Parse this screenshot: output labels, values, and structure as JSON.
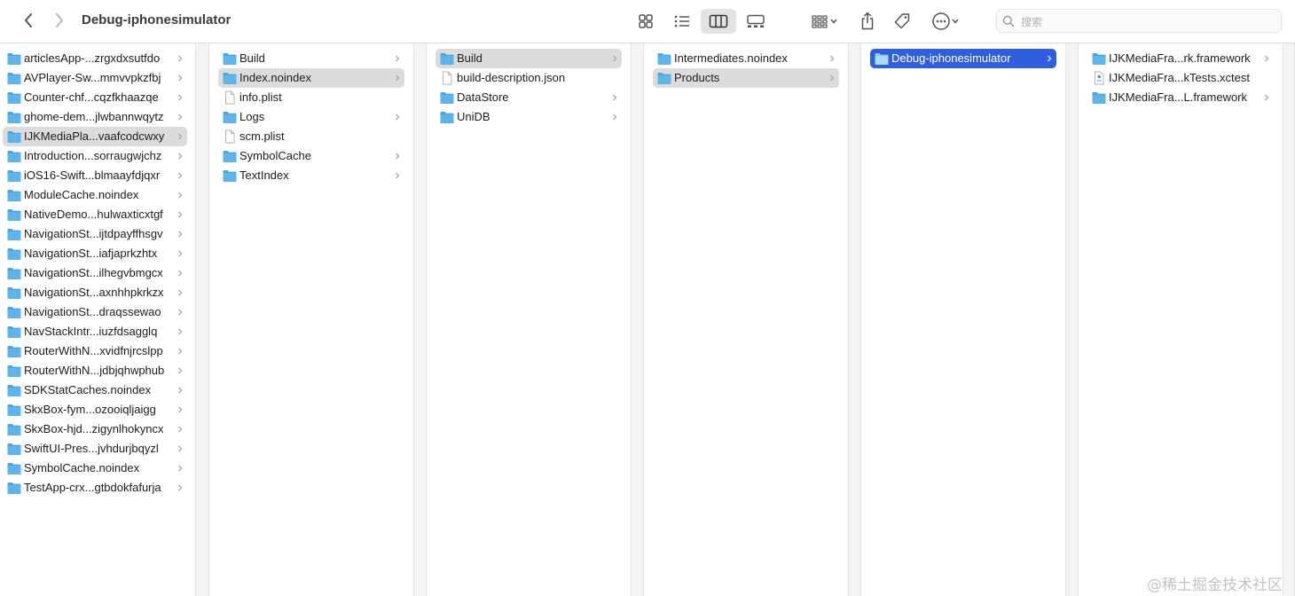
{
  "window": {
    "title": "Debug-iphonesimulator"
  },
  "search": {
    "placeholder": "搜索"
  },
  "toolbar": {
    "buttons": [
      "grid-view",
      "list-view",
      "column-view",
      "gallery-view",
      "group-menu",
      "share",
      "tags",
      "more-actions"
    ],
    "active_view": "column-view"
  },
  "colors": {
    "folder": "#5fb4ea",
    "selection_blue": "#2f5fdc",
    "selection_gray": "#dcdcdc"
  },
  "columns": [
    {
      "items": [
        {
          "label": "articlesApp-...zrgxdxsutfdo",
          "type": "folder",
          "has_children": true
        },
        {
          "label": "AVPlayer-Sw...mmvvpkzfbj",
          "type": "folder",
          "has_children": true
        },
        {
          "label": "Counter-chf...cqzfkhaazqe",
          "type": "folder",
          "has_children": true
        },
        {
          "label": "ghome-dem...jlwbannwqytz",
          "type": "folder",
          "has_children": true
        },
        {
          "label": "IJKMediaPla...vaafcodcwxy",
          "type": "folder",
          "has_children": true,
          "selected": "gray"
        },
        {
          "label": "Introduction...sorraugwjchz",
          "type": "folder",
          "has_children": true
        },
        {
          "label": "iOS16-Swift...blmaayfdjqxr",
          "type": "folder",
          "has_children": true
        },
        {
          "label": "ModuleCache.noindex",
          "type": "folder",
          "has_children": true
        },
        {
          "label": "NativeDemo...hulwaxticxtgf",
          "type": "folder",
          "has_children": true
        },
        {
          "label": "NavigationSt...ijtdpayffhsgv",
          "type": "folder",
          "has_children": true
        },
        {
          "label": "NavigationSt...iafjaprkzhtx",
          "type": "folder",
          "has_children": true
        },
        {
          "label": "NavigationSt...ilhegvbmgcx",
          "type": "folder",
          "has_children": true
        },
        {
          "label": "NavigationSt...axnhhpkrkzx",
          "type": "folder",
          "has_children": true
        },
        {
          "label": "NavigationSt...draqssewao",
          "type": "folder",
          "has_children": true
        },
        {
          "label": "NavStackIntr...iuzfdsagglq",
          "type": "folder",
          "has_children": true
        },
        {
          "label": "RouterWithN...xvidfnjrcslpp",
          "type": "folder",
          "has_children": true
        },
        {
          "label": "RouterWithN...jdbjqhwphub",
          "type": "folder",
          "has_children": true
        },
        {
          "label": "SDKStatCaches.noindex",
          "type": "folder",
          "has_children": true
        },
        {
          "label": "SkxBox-fym...ozooiqljaigg",
          "type": "folder",
          "has_children": true
        },
        {
          "label": "SkxBox-hjd...zigynlhokyncx",
          "type": "folder",
          "has_children": true
        },
        {
          "label": "SwiftUI-Pres...jvhdurjbqyzl",
          "type": "folder",
          "has_children": true
        },
        {
          "label": "SymbolCache.noindex",
          "type": "folder",
          "has_children": true
        },
        {
          "label": "TestApp-crx...gtbdokfafurja",
          "type": "folder",
          "has_children": true
        }
      ]
    },
    {
      "items": [
        {
          "label": "Build",
          "type": "folder",
          "has_children": true
        },
        {
          "label": "Index.noindex",
          "type": "folder",
          "has_children": true,
          "selected": "gray"
        },
        {
          "label": "info.plist",
          "type": "file",
          "has_children": false
        },
        {
          "label": "Logs",
          "type": "folder",
          "has_children": true
        },
        {
          "label": "scm.plist",
          "type": "file",
          "has_children": false
        },
        {
          "label": "SymbolCache",
          "type": "folder",
          "has_children": true
        },
        {
          "label": "TextIndex",
          "type": "folder",
          "has_children": true
        }
      ]
    },
    {
      "items": [
        {
          "label": "Build",
          "type": "folder",
          "has_children": true,
          "selected": "gray"
        },
        {
          "label": "build-description.json",
          "type": "file",
          "has_children": false
        },
        {
          "label": "DataStore",
          "type": "folder",
          "has_children": true
        },
        {
          "label": "UniDB",
          "type": "folder",
          "has_children": true
        }
      ]
    },
    {
      "items": [
        {
          "label": "Intermediates.noindex",
          "type": "folder",
          "has_children": true
        },
        {
          "label": "Products",
          "type": "folder",
          "has_children": true,
          "selected": "gray"
        }
      ]
    },
    {
      "items": [
        {
          "label": "Debug-iphonesimulator",
          "type": "folder",
          "has_children": true,
          "selected": "blue"
        }
      ]
    },
    {
      "items": [
        {
          "label": "IJKMediaFra...rk.framework",
          "type": "folder",
          "has_children": true
        },
        {
          "label": "IJKMediaFra...kTests.xctest",
          "type": "bundle",
          "has_children": false
        },
        {
          "label": "IJKMediaFra...L.framework",
          "type": "folder",
          "has_children": true
        }
      ]
    }
  ],
  "watermark": "@稀土掘金技术社区"
}
